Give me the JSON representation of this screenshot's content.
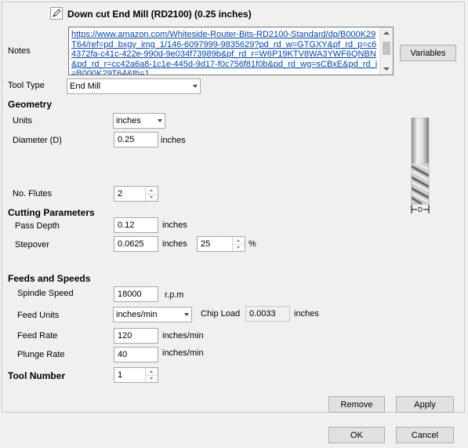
{
  "header": {
    "title": "Down cut End Mill (RD2100) (0.25 inches)",
    "edit_icon": "pencil-edit-icon"
  },
  "notes": {
    "label": "Notes",
    "value": "https://www.amazon.com/Whiteside-Router-Bits-RD2100-Standard/dp/B000K29T64/ref=pd_bxgy_img_1/146-6097999-9835629?pd_rd_w=GTGXY&pf_rd_p=c64372fa-c41c-422e-990d-9e034f73989b&pf_rd_r=W6P19KTV8WA3YWF6QNBN&pd_rd_r=cc42a6a8-1c1e-445d-9d17-f0c756f81f0b&pd_rd_wg=sCBxE&pd_rd_i=B000K29T64&th=1",
    "variables_label": "Variables"
  },
  "tool_type": {
    "label": "Tool Type",
    "value": "End Mill"
  },
  "geometry": {
    "heading": "Geometry",
    "units_label": "Units",
    "units_value": "inches",
    "diameter_label": "Diameter (D)",
    "diameter_value": "0.25",
    "diameter_unit": "inches",
    "flutes_label": "No. Flutes",
    "flutes_value": "2",
    "diagram_label": "D"
  },
  "cutting": {
    "heading": "Cutting Parameters",
    "pass_depth_label": "Pass Depth",
    "pass_depth_value": "0.12",
    "pass_depth_unit": "inches",
    "stepover_label": "Stepover",
    "stepover_value": "0.0625",
    "stepover_unit": "inches",
    "stepover_pct_value": "25",
    "stepover_pct_unit": "%"
  },
  "feeds": {
    "heading": "Feeds and Speeds",
    "spindle_label": "Spindle Speed",
    "spindle_value": "18000",
    "spindle_unit": "r.p.m",
    "feed_units_label": "Feed Units",
    "feed_units_value": "inches/min",
    "chip_load_label": "Chip Load",
    "chip_load_value": "0.0033",
    "chip_load_unit": "inches",
    "feed_rate_label": "Feed Rate",
    "feed_rate_value": "120",
    "feed_rate_unit": "inches/min",
    "plunge_rate_label": "Plunge Rate",
    "plunge_rate_value": "40",
    "plunge_rate_unit": "inches/min"
  },
  "tool_number": {
    "heading": "Tool Number",
    "value": "1"
  },
  "buttons": {
    "remove": "Remove",
    "apply": "Apply",
    "ok": "OK",
    "cancel": "Cancel"
  }
}
